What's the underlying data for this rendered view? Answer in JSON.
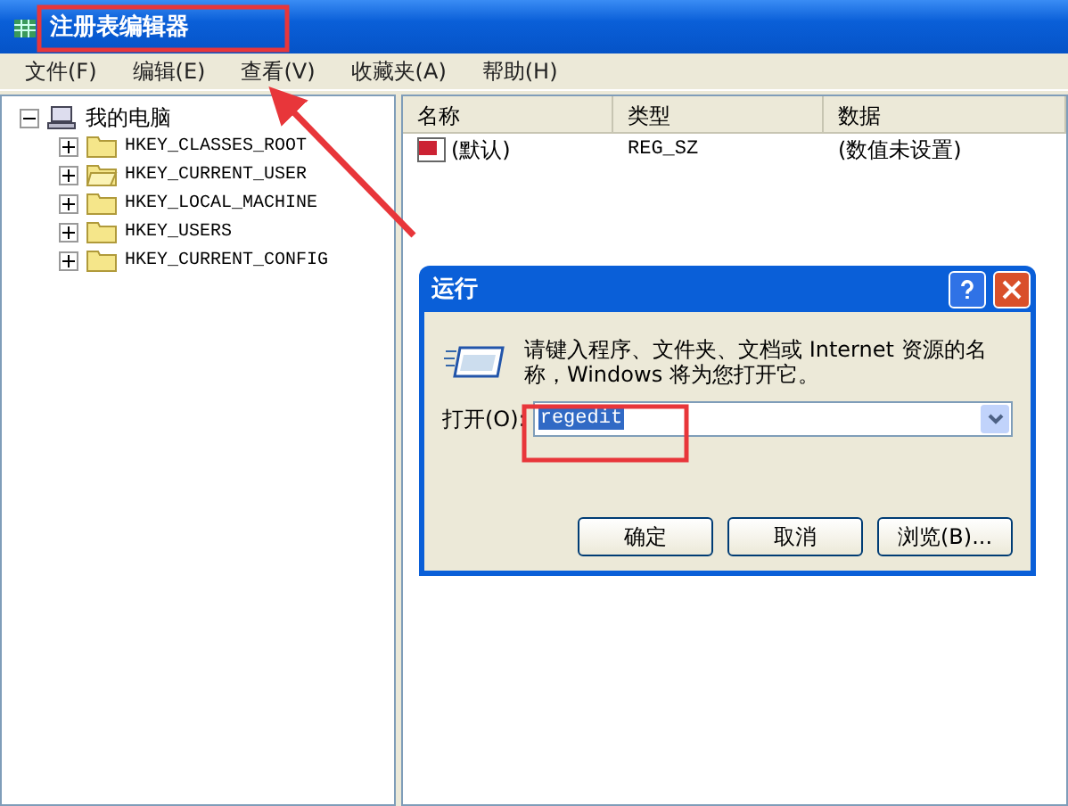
{
  "window": {
    "title": "注册表编辑器"
  },
  "menu": [
    {
      "label": "文件(F)"
    },
    {
      "label": "编辑(E)"
    },
    {
      "label": "查看(V)"
    },
    {
      "label": "收藏夹(A)"
    },
    {
      "label": "帮助(H)"
    }
  ],
  "tree": {
    "label": "我的电脑",
    "expanded": true,
    "children": [
      {
        "label": "HKEY_CLASSES_ROOT",
        "expanded": false,
        "selected": false
      },
      {
        "label": "HKEY_CURRENT_USER",
        "expanded": false,
        "selected": true
      },
      {
        "label": "HKEY_LOCAL_MACHINE",
        "expanded": false,
        "selected": false
      },
      {
        "label": "HKEY_USERS",
        "expanded": false,
        "selected": false
      },
      {
        "label": "HKEY_CURRENT_CONFIG",
        "expanded": false,
        "selected": false
      }
    ]
  },
  "list": {
    "columns": [
      "名称",
      "类型",
      "数据"
    ],
    "rows": [
      {
        "name": "(默认)",
        "type": "REG_SZ",
        "data": "(数值未设置)"
      }
    ]
  },
  "run_dialog": {
    "title": "运行",
    "prompt": "请键入程序、文件夹、文档或 Internet 资源的名称，Windows 将为您打开它。",
    "open_label": "打开(O):",
    "value": "regedit",
    "value_selected": true,
    "buttons": [
      "确定",
      "取消",
      "浏览(B)..."
    ]
  },
  "annotations": [
    {
      "kind": "box"
    },
    {
      "kind": "box"
    },
    {
      "kind": "arrow"
    }
  ]
}
